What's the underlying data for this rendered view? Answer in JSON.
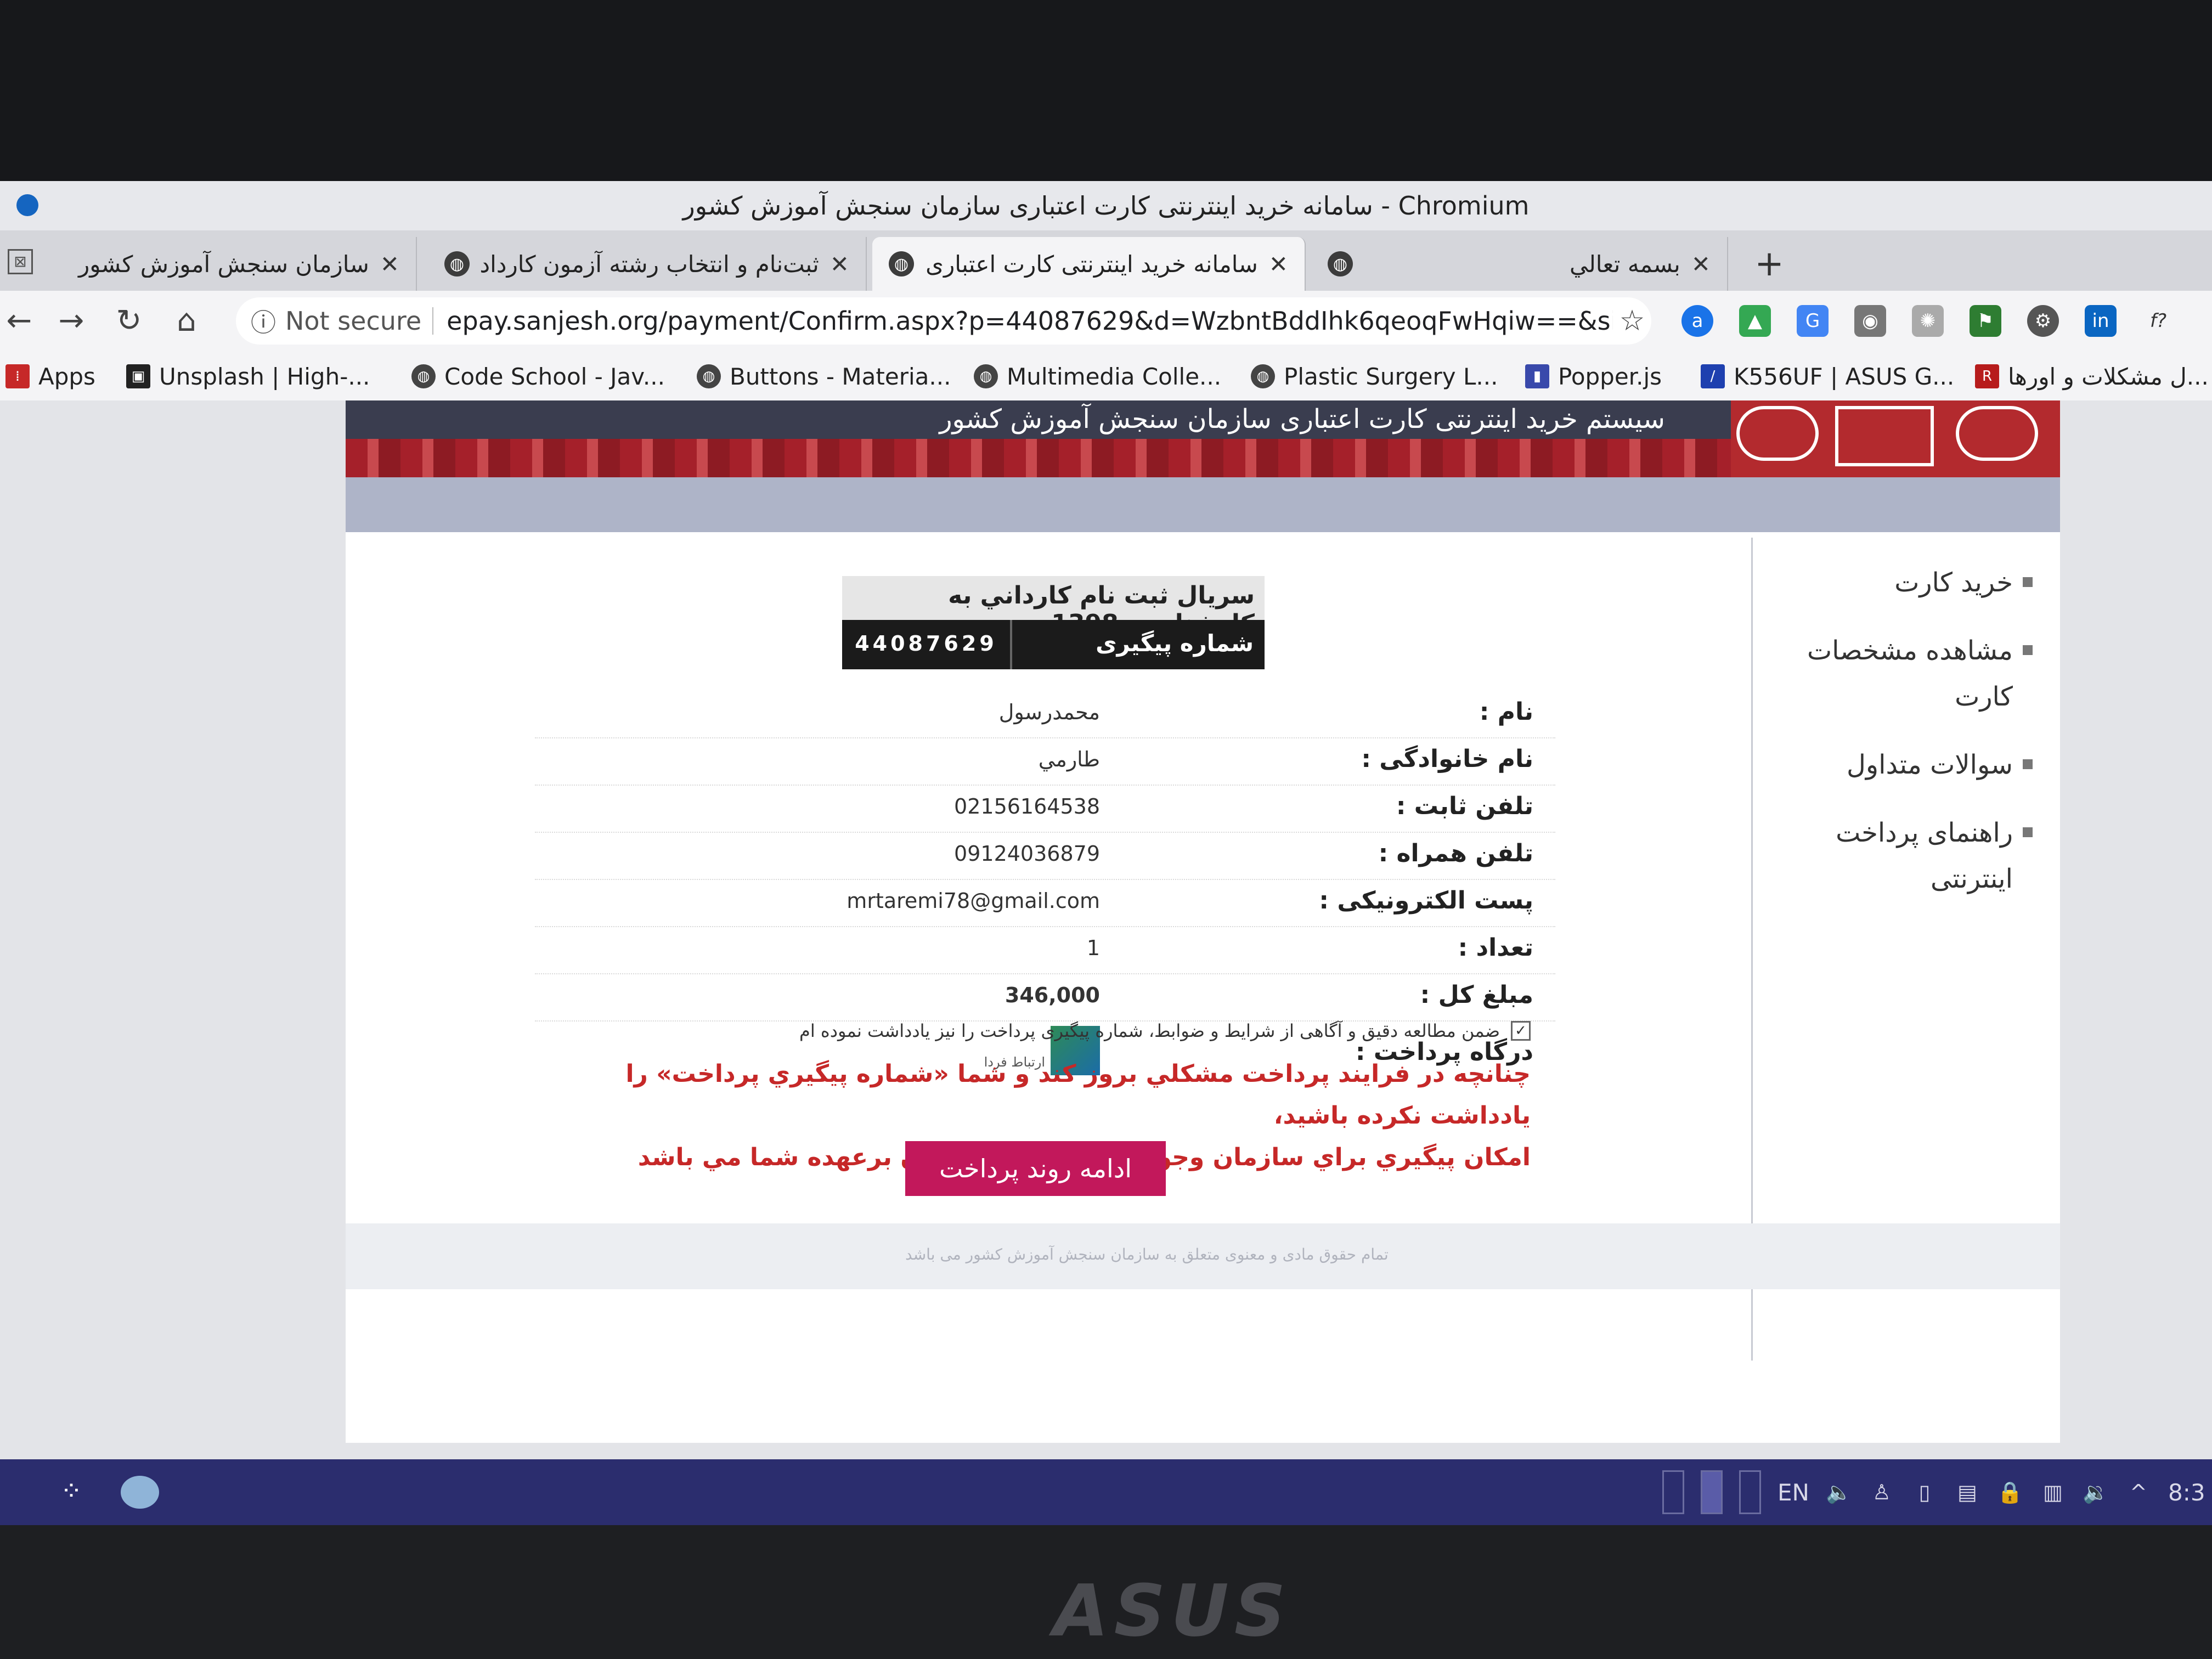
{
  "window": {
    "title": "سامانه خرید اینترنتی کارت اعتباری سازمان سنجش آموزش کشور - Chromium"
  },
  "tabs": [
    {
      "label": "سازمان سنجش آموزش کشور"
    },
    {
      "label": "ثبت‌نام و انتخاب رشته آزمون کارداد"
    },
    {
      "label": "سامانه خرید اینترنتی کارت اعتباری",
      "active": true
    },
    {
      "label": "بسمه تعالي"
    }
  ],
  "address_bar": {
    "security_label": "Not secure",
    "url": "epay.sanjesh.org/payment/Confirm.aspx?p=44087629&d=WzbntBddIhk6qeoqFwHqiw==&si..."
  },
  "bookmarks": [
    {
      "label": "Apps"
    },
    {
      "label": "Unsplash | High-..."
    },
    {
      "label": "Code School - Jav..."
    },
    {
      "label": "Buttons - Materia..."
    },
    {
      "label": "Multimedia Colle..."
    },
    {
      "label": "Plastic Surgery L..."
    },
    {
      "label": "Popper.js"
    },
    {
      "label": "K556UF | ASUS G..."
    },
    {
      "label": "ل مشکلات و اورها..."
    }
  ],
  "banner": {
    "title": "سیستم خرید اینترنتی کارت اعتباری سازمان سنجش آموزش کشور"
  },
  "sidebar": {
    "items": [
      {
        "label": "خرید کارت"
      },
      {
        "label": "مشاهده مشخصات کارت"
      },
      {
        "label": "سوالات متداول"
      },
      {
        "label": "راهنمای پرداخت اینترنتی"
      }
    ]
  },
  "order": {
    "serial_title": "سريال ثبت نام كارداني به كارشناسي 1398",
    "tracking_label": "شماره پیگیری پرداخت",
    "tracking_number": "44087629"
  },
  "form": {
    "rows": [
      {
        "label": "نام :",
        "value": "محمدرسول"
      },
      {
        "label": "نام خانوادگی :",
        "value": "طارمي"
      },
      {
        "label": "تلفن ثابت :",
        "value": "02156164538"
      },
      {
        "label": "تلفن همراه :",
        "value": "09124036879"
      },
      {
        "label": "پست الکترونیکی :",
        "value": "mrtaremi78@gmail.com"
      },
      {
        "label": "تعداد :",
        "value": "1"
      },
      {
        "label": "مبلغ کل :",
        "value": "346,000"
      },
      {
        "label": "درگاه پرداخت :",
        "value": "ارتباط فردا"
      }
    ]
  },
  "agreement": {
    "text": "ضمن مطالعه دقیق و آگاهی از شرایط و ضوابط، شماره پیگیری پرداخت را نیز یادداشت نموده ام",
    "checked": true
  },
  "warning": {
    "line1": "چنانچه در فرایند پرداخت مشکلي بروز کند و شما «شماره پيگيري پرداخت» را يادداشت نکرده باشيد،",
    "line2": "امکان پيگيري براي سازمان وجود ندارد و مسئوليت آن برعهده شما مي باشد"
  },
  "continue_button": {
    "label": "ادامه روند پرداخت"
  },
  "footer": {
    "text": "تمام حقوق مادی و معنوی متعلق به سازمان سنجش آموزش کشور می باشد"
  },
  "taskbar": {
    "language": "EN",
    "clock": "8:3"
  },
  "laptop": {
    "brand": "ASUS"
  },
  "colors": {
    "accent_red": "#b32a2e",
    "button": "#c2185b",
    "warning": "#c62828",
    "taskbar": "#2b2d6e"
  }
}
